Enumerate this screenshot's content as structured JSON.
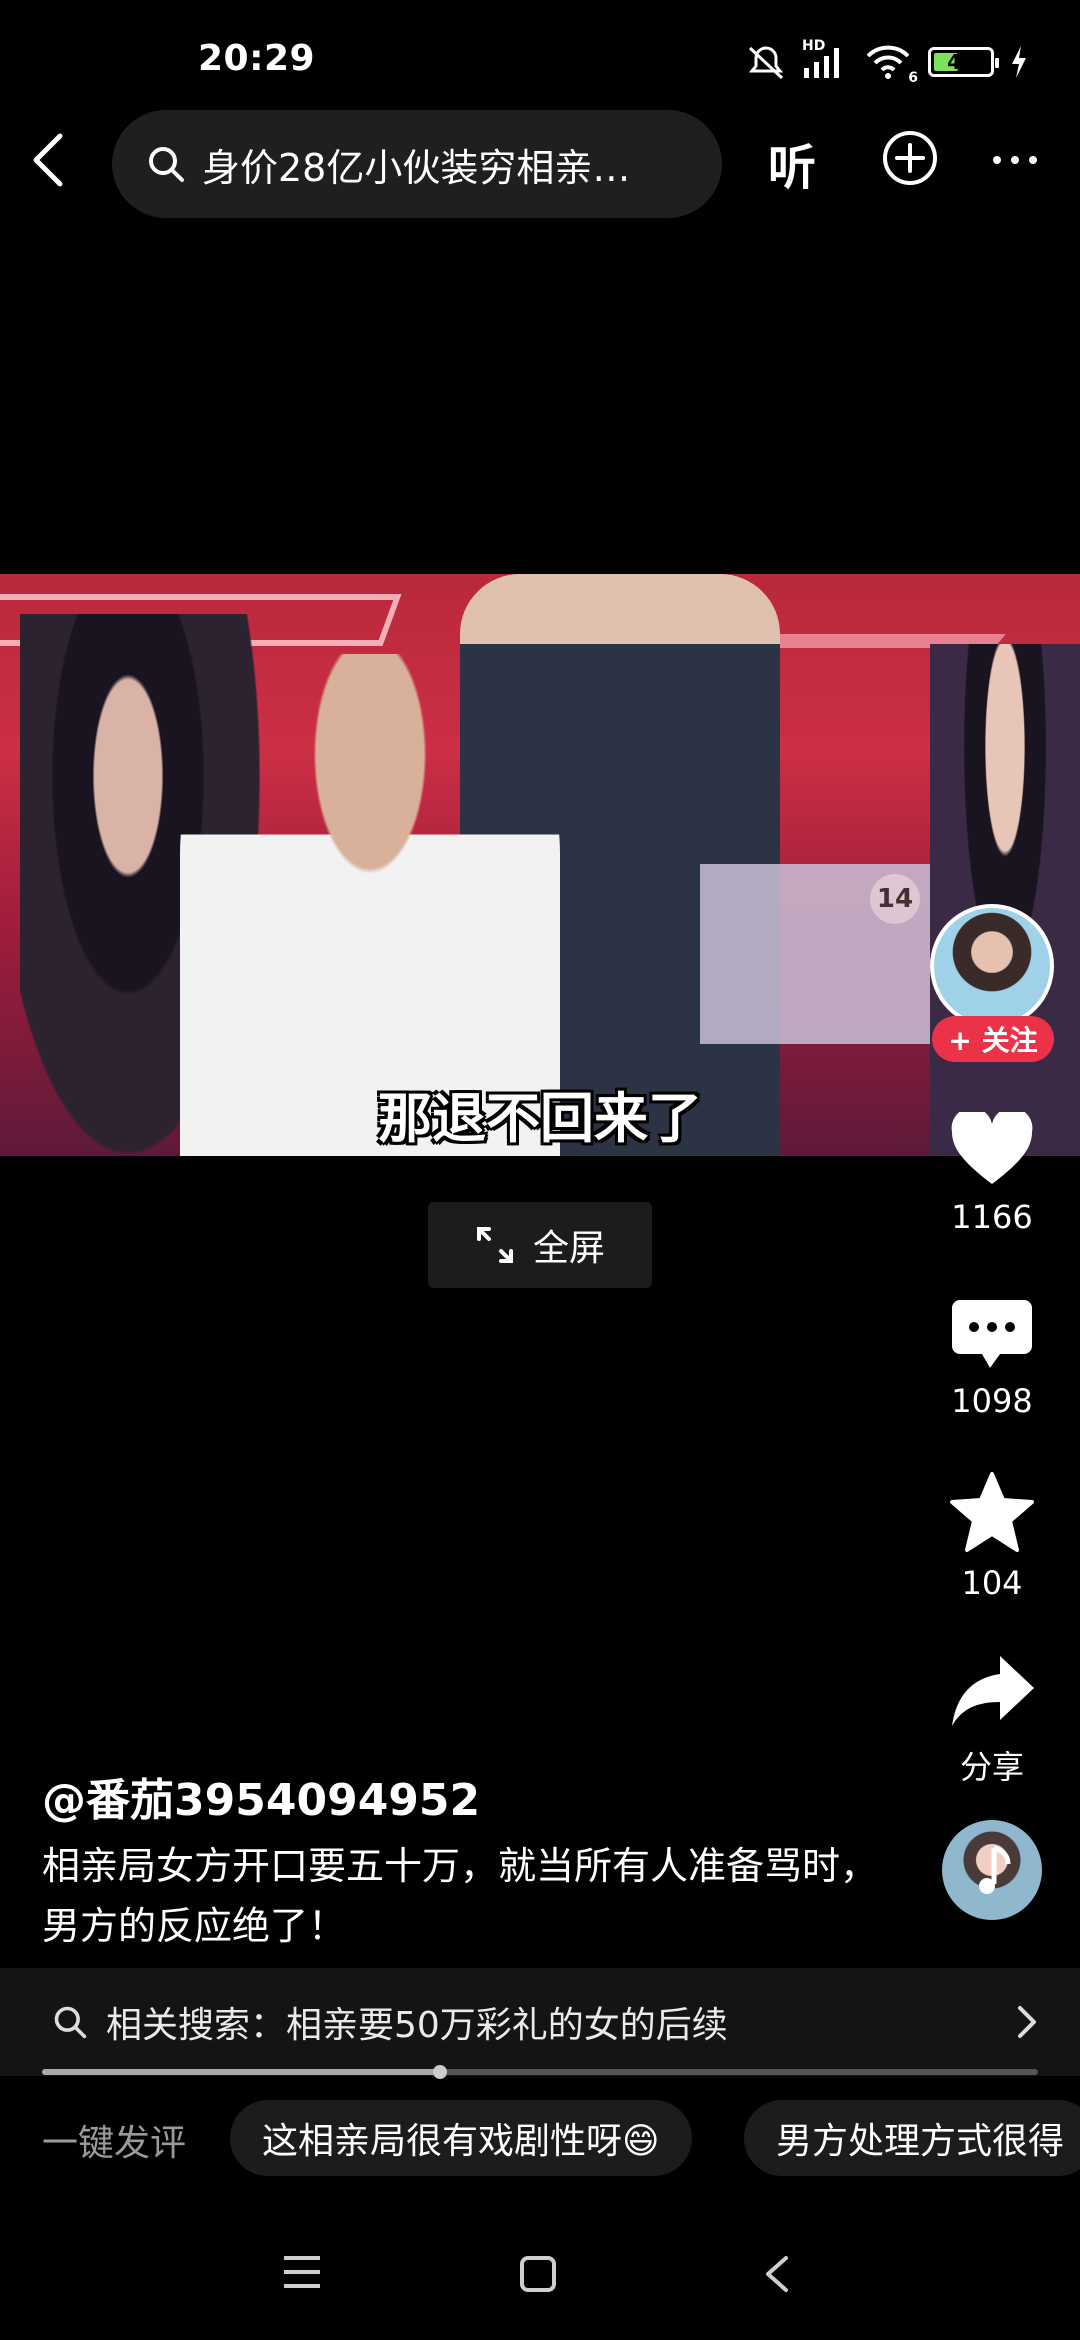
{
  "status_bar": {
    "time": "20:29",
    "battery": "44",
    "battery_level": 0.44,
    "network": "HD",
    "wifi_badge": "6"
  },
  "top_bar": {
    "search_text": "身价28亿小伙装穷相亲…",
    "listen_label": "听"
  },
  "video": {
    "subtitle": "那退不回来了",
    "player_number": "14"
  },
  "fullscreen_label": "全屏",
  "rail": {
    "follow_label": "+ 关注",
    "likes": "1166",
    "comments": "1098",
    "favorites": "104",
    "share_label": "分享"
  },
  "post": {
    "author": "@番茄3954094952",
    "description": "相亲局女方开口要五十万，就当所有人准备骂时，男方的反应绝了！"
  },
  "related": {
    "text": "相关搜索：相亲要50万彩礼的女的后续"
  },
  "progress": 0.4,
  "quick_comments": {
    "label": "一键发评",
    "chips": [
      "这相亲局很有戏剧性呀😄",
      "男方处理方式很得"
    ]
  },
  "colors": {
    "accent": "#ea3348",
    "background": "#000000"
  },
  "icons": [
    "back-icon",
    "search-icon",
    "add-circle-icon",
    "more-icon",
    "expand-icon",
    "heart-icon",
    "comment-icon",
    "star-icon",
    "share-icon",
    "chevron-right-icon",
    "menu-icon",
    "home-icon",
    "back-nav-icon"
  ]
}
